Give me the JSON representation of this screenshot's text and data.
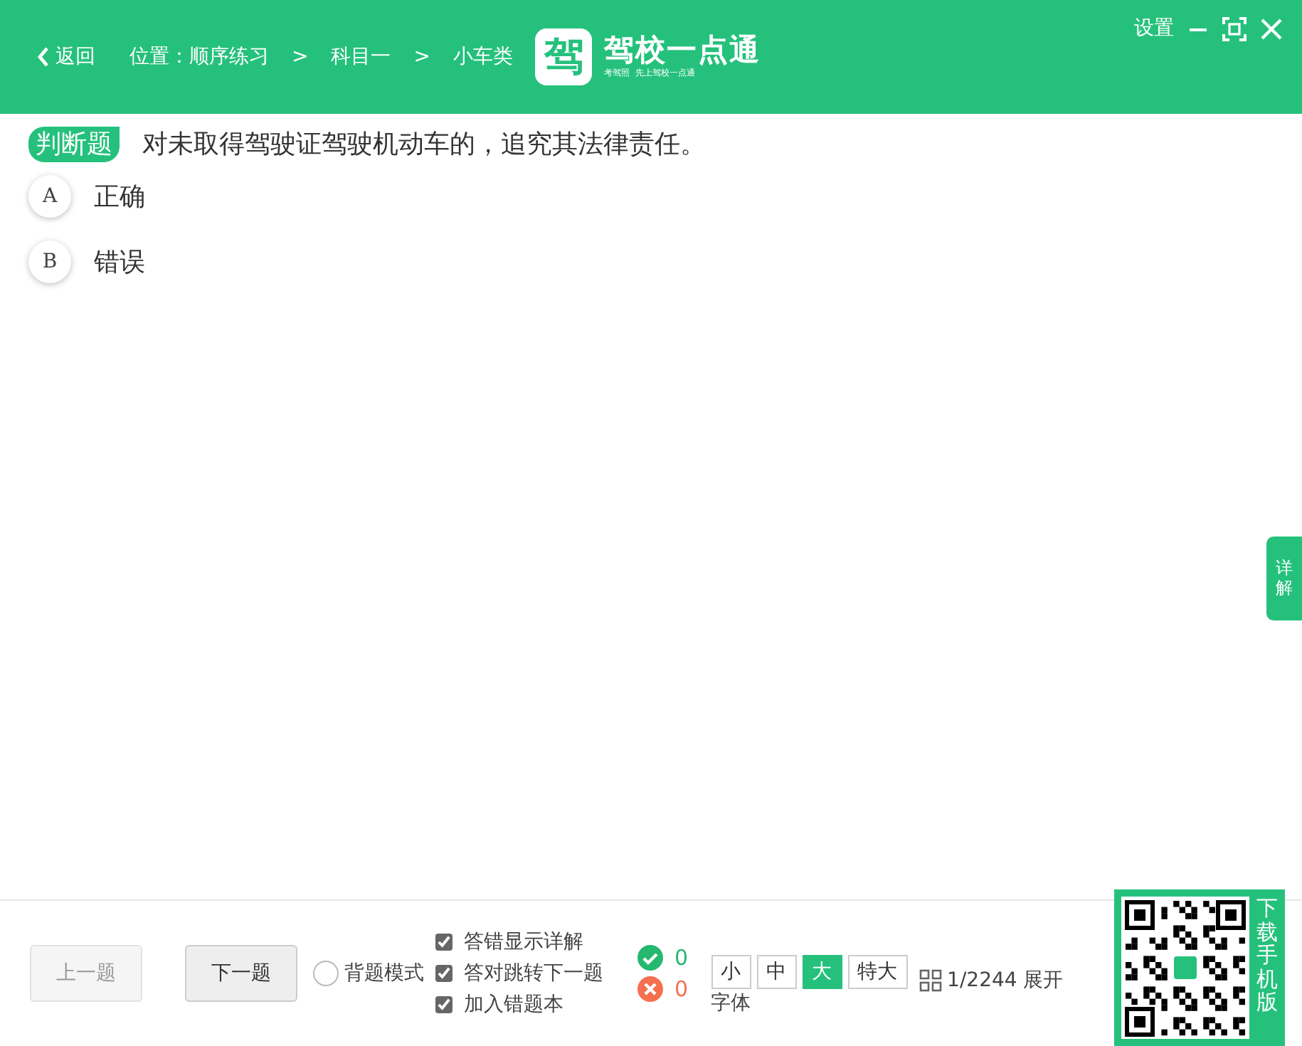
{
  "header": {
    "back": "返回",
    "location": [
      {
        "text": "位置：顺序练习"
      },
      {
        "text": ">"
      },
      {
        "text": "科目一"
      },
      {
        "text": ">"
      },
      {
        "text": "小车类"
      }
    ],
    "logo": {
      "glyph": "驾",
      "name": "驾校一点通",
      "slogan": "考驾照  先上驾校一点通"
    },
    "settings": "设置"
  },
  "question": {
    "type_label": "判断题",
    "text": "对未取得驾驶证驾驶机动车的，追究其法律责任。",
    "options": [
      {
        "letter": "A",
        "text": "正确"
      },
      {
        "letter": "B",
        "text": "错误"
      }
    ]
  },
  "side_tab": "详解",
  "footer": {
    "prev": {
      "label": "上一题",
      "disabled": true
    },
    "next": {
      "label": "下一题",
      "disabled": false
    },
    "recite_mode": {
      "label": "背题模式",
      "selected": false
    },
    "options": [
      {
        "label": "答错显示详解",
        "checked": true
      },
      {
        "label": "答对跳转下一题",
        "checked": true
      },
      {
        "label": "加入错题本",
        "checked": true
      }
    ],
    "correct_count": "0",
    "wrong_count": "0",
    "font_sizes": [
      {
        "label": "小",
        "selected": false
      },
      {
        "label": "中",
        "selected": false
      },
      {
        "label": "大",
        "selected": true
      },
      {
        "label": "特大",
        "selected": false
      }
    ],
    "font_label": "字体",
    "position": "1/2244",
    "expand": "展开",
    "download": "下载手机版"
  }
}
